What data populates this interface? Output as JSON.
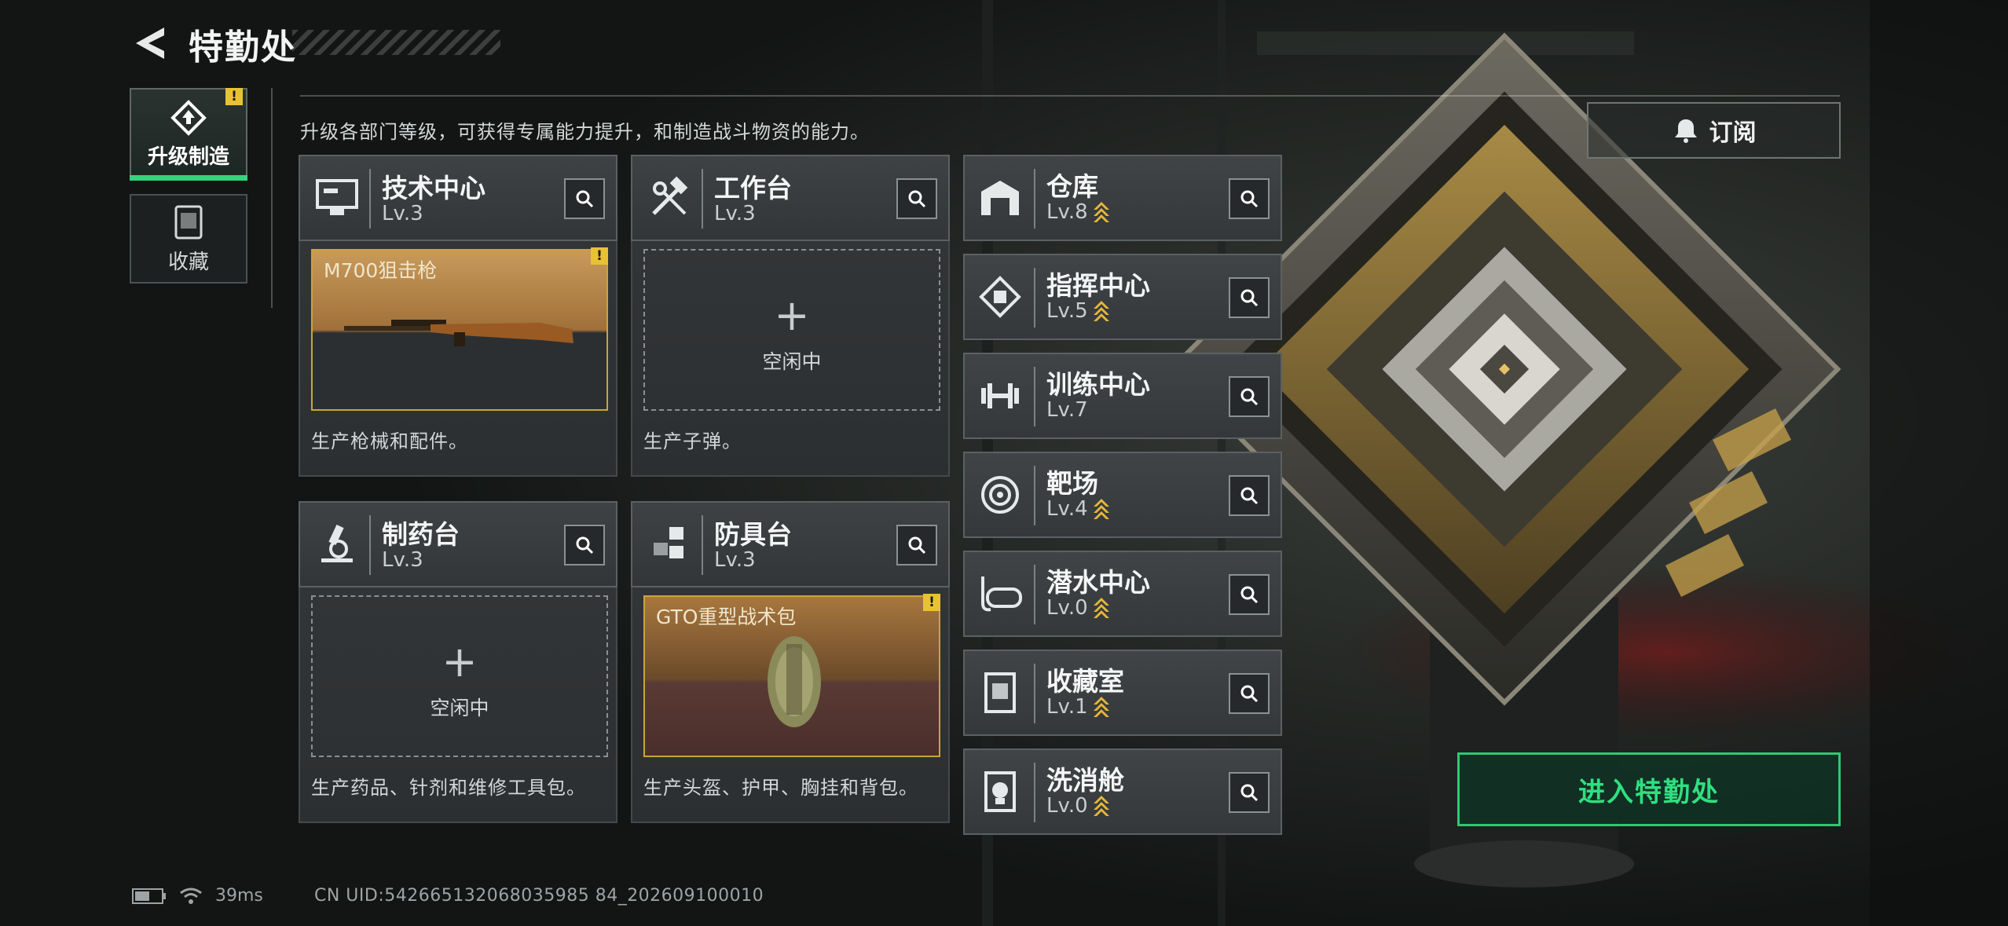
{
  "header": {
    "title": "特勤处"
  },
  "tabs": [
    {
      "label": "升级制造",
      "warn": "!"
    },
    {
      "label": "收藏"
    }
  ],
  "description": "升级各部门等级，可获得专属能力提升，和制造战斗物资的能力。",
  "subscribe_label": "订阅",
  "cards": [
    {
      "name": "技术中心",
      "level": "Lv.3",
      "slot": {
        "item_name": "M700狙击枪",
        "warn": "!"
      },
      "footer": "生产枪械和配件。"
    },
    {
      "name": "工作台",
      "level": "Lv.3",
      "slot": {
        "idle_label": "空闲中"
      },
      "footer": "生产子弹。"
    },
    {
      "name": "制药台",
      "level": "Lv.3",
      "slot": {
        "idle_label": "空闲中"
      },
      "footer": "生产药品、针剂和维修工具包。"
    },
    {
      "name": "防具台",
      "level": "Lv.3",
      "slot": {
        "item_name": "GTO重型战术包",
        "warn": "!"
      },
      "footer": "生产头盔、护甲、胸挂和背包。"
    }
  ],
  "departments": [
    {
      "name": "仓库",
      "level": "Lv.8",
      "upgradable": true
    },
    {
      "name": "指挥中心",
      "level": "Lv.5",
      "upgradable": true
    },
    {
      "name": "训练中心",
      "level": "Lv.7",
      "upgradable": false
    },
    {
      "name": "靶场",
      "level": "Lv.4",
      "upgradable": true
    },
    {
      "name": "潜水中心",
      "level": "Lv.0",
      "upgradable": true
    },
    {
      "name": "收藏室",
      "level": "Lv.1",
      "upgradable": true
    },
    {
      "name": "洗消舱",
      "level": "Lv.0",
      "upgradable": true
    }
  ],
  "enter_label": "进入特勤处",
  "status": {
    "ping": "39ms",
    "uid": "CN UID:542665132068035985 84_202609100010"
  },
  "colors": {
    "accent_green": "#2fd67a",
    "warn_yellow": "#e8c233",
    "upgrade_chevron": "#e5b73b"
  }
}
